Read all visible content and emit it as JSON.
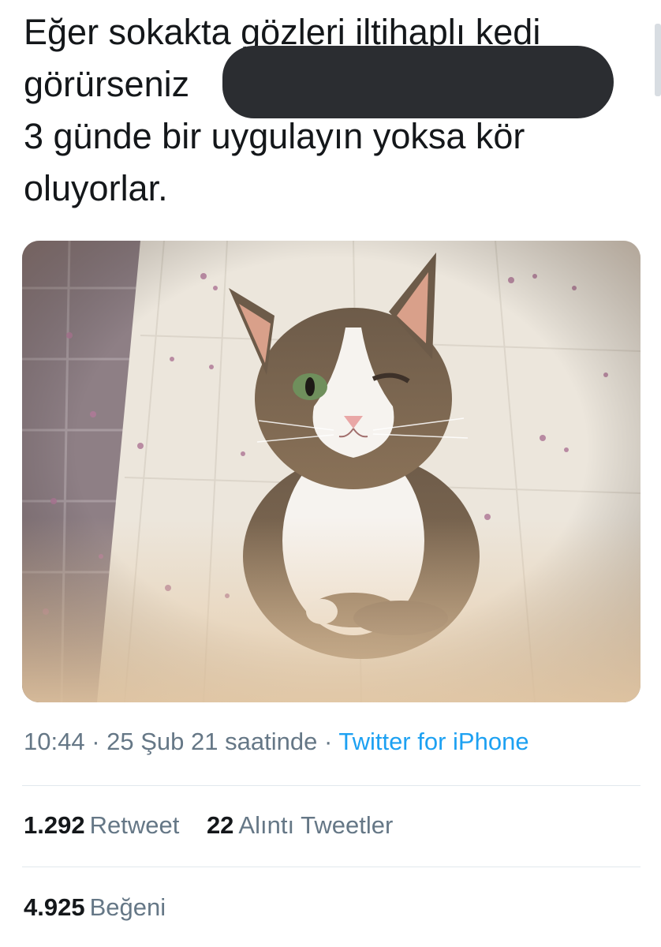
{
  "tweet": {
    "text_lines": [
      "Eğer sokakta gözleri iltihaplı kedi",
      "görürseniz",
      "3 günde bir uygulayın yoksa kör",
      "oluyorlar."
    ],
    "time": "10:44",
    "date": "25 Şub 21 saatinde",
    "separator": "·",
    "source": "Twitter for iPhone"
  },
  "stats": {
    "retweets": {
      "count": "1.292",
      "label": "Retweet"
    },
    "quotes": {
      "count": "22",
      "label": "Alıntı Tweetler"
    },
    "likes": {
      "count": "4.925",
      "label": "Beğeni"
    }
  },
  "colors": {
    "text": "#14171a",
    "secondary": "#657786",
    "link": "#1da1f2",
    "divider": "#e1e8ed"
  }
}
